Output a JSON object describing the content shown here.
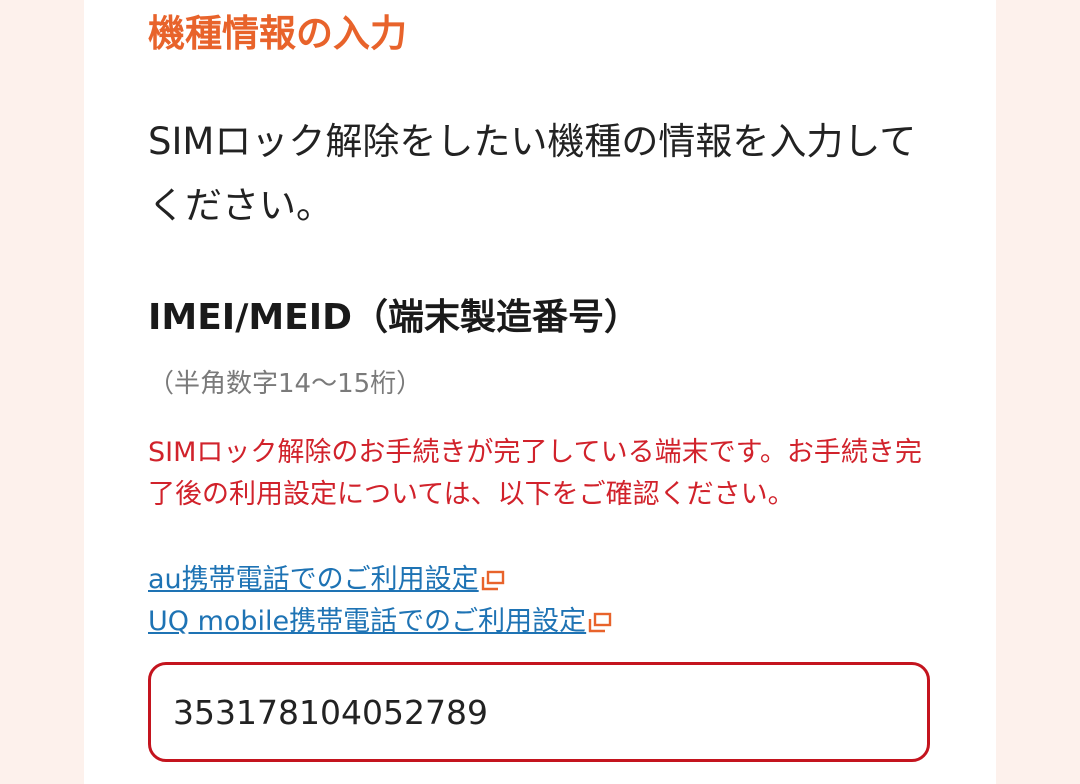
{
  "section": {
    "heading": "機種情報の入力",
    "intro": "SIMロック解除をしたい機種の情報を入力してください。"
  },
  "field": {
    "label": "IMEI/MEID（端末製造番号）",
    "hint": "（半角数字14〜15桁）",
    "value": "353178104052789"
  },
  "error": {
    "message": "SIMロック解除のお手続きが完了している端末です。お手続き完了後の利用設定については、以下をご確認ください。"
  },
  "links": {
    "au": "au携帯電話でのご利用設定",
    "uq": "UQ mobile携帯電話でのご利用設定"
  },
  "colors": {
    "heading": "#e8632b",
    "error": "#d1222b",
    "link": "#1e73b4",
    "input_border": "#c4141e",
    "page_bg": "#fdf1ec"
  }
}
